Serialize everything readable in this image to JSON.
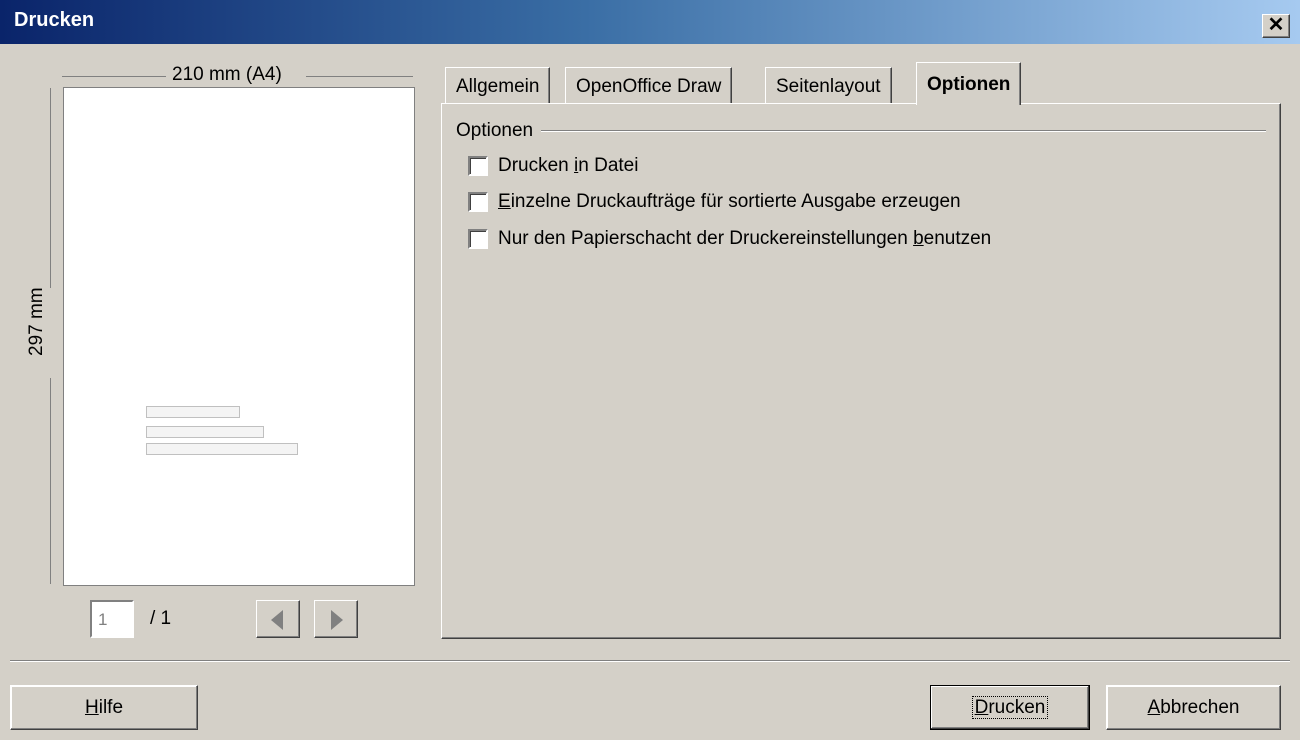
{
  "window": {
    "title": "Drucken",
    "close_glyph": "✕"
  },
  "preview": {
    "width_label": "210 mm (A4)",
    "height_label": "297 mm",
    "page_current": "1",
    "page_total": "/ 1"
  },
  "tabs": [
    {
      "label": "Allgemein",
      "active": false
    },
    {
      "label": "OpenOffice Draw",
      "active": false
    },
    {
      "label": "Seitenlayout",
      "active": false
    },
    {
      "label": "Optionen",
      "active": true
    }
  ],
  "options_group": {
    "label": "Optionen",
    "items": [
      {
        "pre": "Drucken ",
        "mnemonic": "i",
        "post": "n Datei",
        "checked": false
      },
      {
        "pre": "",
        "mnemonic": "E",
        "post": "inzelne Druckaufträge für sortierte Ausgabe erzeugen",
        "checked": false
      },
      {
        "pre": "Nur den Papierschacht der Druckereinstellungen ",
        "mnemonic": "b",
        "post": "enutzen",
        "checked": false
      }
    ]
  },
  "buttons": {
    "help": {
      "mnemonic": "H",
      "rest": "ilfe"
    },
    "print": {
      "mnemonic": "D",
      "rest": "rucken"
    },
    "cancel": {
      "mnemonic": "A",
      "rest": "bbrechen"
    }
  },
  "colors": {
    "dialog_bg": "#d4d0c8",
    "title_start": "#0a246a",
    "title_end": "#a6caf0"
  }
}
